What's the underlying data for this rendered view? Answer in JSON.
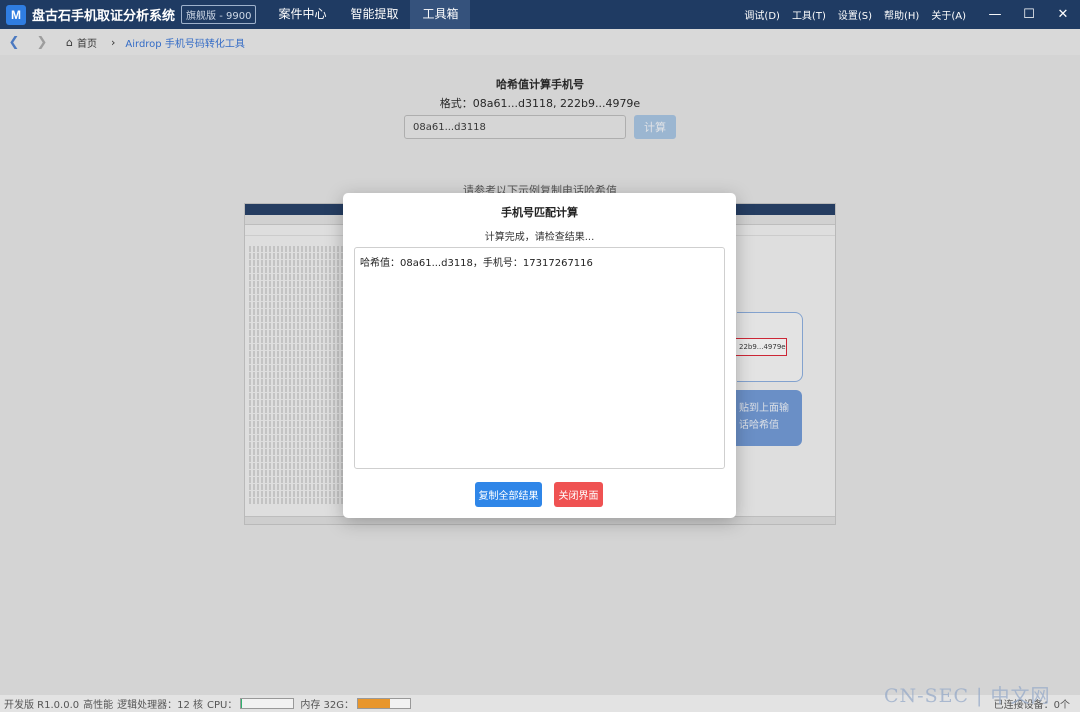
{
  "app": {
    "title": "盘古石手机取证分析系统",
    "edition": "旗舰版 - 9900",
    "logo_letter": "M",
    "nav": [
      "案件中心",
      "智能提取",
      "工具箱"
    ],
    "active_nav": "工具箱",
    "menu": [
      "调试(D)",
      "工具(T)",
      "设置(S)",
      "帮助(H)",
      "关于(A)"
    ],
    "window_controls": {
      "minimize": "minimize-icon",
      "maximize": "maximize-icon",
      "close": "close-icon"
    }
  },
  "breadcrumb": {
    "home": "首页",
    "current": "Airdrop 手机号码转化工具"
  },
  "page": {
    "title": "哈希值计算手机号",
    "format_label": "格式：08a61...d3118, 222b9...4979e",
    "input_value": "08a61...d3118",
    "calc_button": "计算",
    "example_hint": "请参考以下示例复制电话哈希值"
  },
  "example_image": {
    "hash_box_text": "22b9...4979e",
    "blue_box_lines": [
      "贴到上面输",
      "话哈希值"
    ]
  },
  "dialog": {
    "title": "手机号匹配计算",
    "subtitle": "计算完成，请检查结果...",
    "result": "哈希值：08a61...d3118，手机号：17317267116",
    "copy_button": "复制全部结果",
    "close_button": "关闭界面"
  },
  "statusbar": {
    "version": "开发版 R1.0.0.0",
    "performance": "高性能",
    "cpu_cores": "逻辑处理器：12 核",
    "cpu_label": "CPU：",
    "cpu_usage_fraction": 0.02,
    "memory_label": "内存 32G：",
    "memory_usage_fraction": 0.62,
    "connection": "已连接设备：0个",
    "colors": {
      "cpu": "#2fb36f",
      "memory": "#e8962c"
    }
  },
  "watermark": "CN-SEC | 中文网"
}
